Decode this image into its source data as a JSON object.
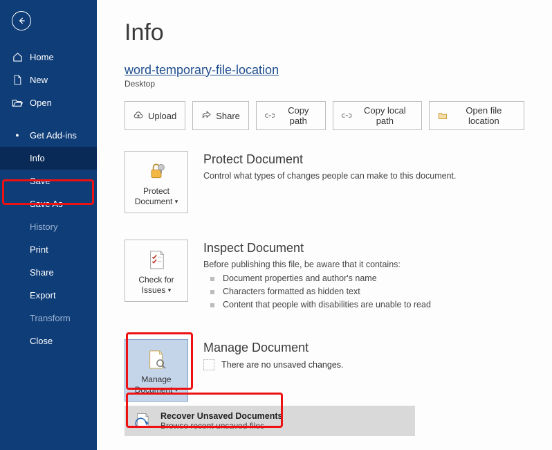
{
  "sidebar": {
    "items": [
      {
        "label": "Home"
      },
      {
        "label": "New"
      },
      {
        "label": "Open"
      },
      {
        "label": "Get Add-ins"
      },
      {
        "label": "Info"
      },
      {
        "label": "Save"
      },
      {
        "label": "Save As"
      },
      {
        "label": "History"
      },
      {
        "label": "Print"
      },
      {
        "label": "Share"
      },
      {
        "label": "Export"
      },
      {
        "label": "Transform"
      },
      {
        "label": "Close"
      }
    ]
  },
  "page": {
    "title": "Info",
    "file_title": "word-temporary-file-location",
    "file_subtitle": "Desktop"
  },
  "actions": {
    "upload": "Upload",
    "share": "Share",
    "copy_path": "Copy path",
    "copy_local_path": "Copy local path",
    "open_location": "Open file location"
  },
  "protect": {
    "btn_line1": "Protect",
    "btn_line2": "Document",
    "title": "Protect Document",
    "desc": "Control what types of changes people can make to this document."
  },
  "inspect": {
    "btn_line1": "Check for",
    "btn_line2": "Issues",
    "title": "Inspect Document",
    "desc": "Before publishing this file, be aware that it contains:",
    "items": [
      "Document properties and author's name",
      "Characters formatted as hidden text",
      "Content that people with disabilities are unable to read"
    ]
  },
  "manage": {
    "btn_line1": "Manage",
    "btn_line2": "Document",
    "title": "Manage Document",
    "desc": "There are no unsaved changes.",
    "recover_title": "Recover Unsaved Documents",
    "recover_sub": "Browse recent unsaved files"
  }
}
